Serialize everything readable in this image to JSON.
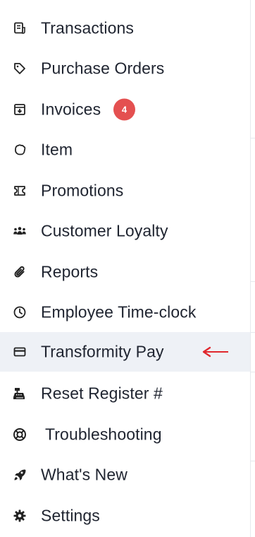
{
  "menu": {
    "items": [
      {
        "label": "Transactions",
        "icon": "receipt-icon"
      },
      {
        "label": "Purchase Orders",
        "icon": "tag-icon"
      },
      {
        "label": "Invoices",
        "icon": "inbox-download-icon",
        "badge": "4"
      },
      {
        "label": "Item",
        "icon": "hand-icon"
      },
      {
        "label": "Promotions",
        "icon": "ticket-icon"
      },
      {
        "label": "Customer Loyalty",
        "icon": "users-icon"
      },
      {
        "label": "Reports",
        "icon": "paperclip-icon"
      },
      {
        "label": "Employee Time-clock",
        "icon": "clock-icon"
      },
      {
        "label": "Transformity Pay",
        "icon": "credit-card-icon",
        "active": true
      },
      {
        "label": "Reset Register #",
        "icon": "cash-register-icon"
      },
      {
        "label": "Troubleshooting",
        "icon": "life-ring-icon"
      },
      {
        "label": "What's New",
        "icon": "rocket-icon"
      },
      {
        "label": "Settings",
        "icon": "gear-icon"
      }
    ]
  },
  "colors": {
    "active_bg": "#eef1f6",
    "badge_bg": "#e45050",
    "arrow": "#e0282e",
    "text": "#1f2430"
  }
}
